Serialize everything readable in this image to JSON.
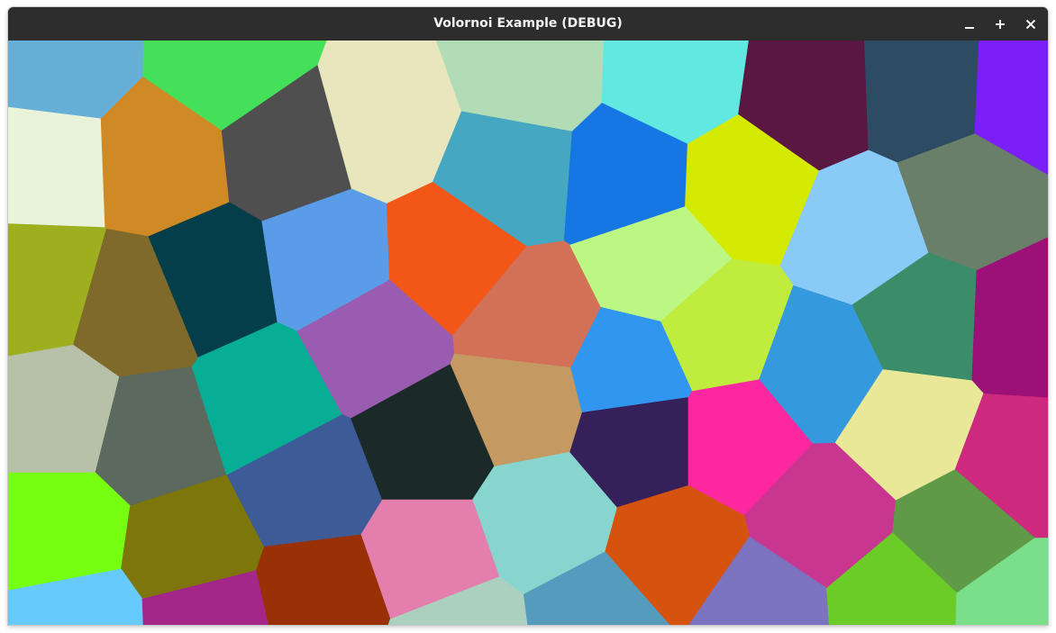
{
  "window": {
    "title": "Volornoi Example (DEBUG)",
    "controls": {
      "minimize_icon": "minimize-icon",
      "maximize_icon": "maximize-icon",
      "close_icon": "close-icon"
    }
  },
  "canvas": {
    "cell_colors": [
      "#66b0d8",
      "#44e05a",
      "#e9f3d9",
      "#d08a25",
      "#4f4f4f",
      "#e8e6bc",
      "#b1dcb6",
      "#61e9e1",
      "#5a1742",
      "#2d4c64",
      "#7b1ef8",
      "#45a7c1",
      "#1677e4",
      "#d4ea00",
      "#89caf7",
      "#6a7f69",
      "#9dae1f",
      "#7f6a2c",
      "#033e4a",
      "#5b9ce8",
      "#f35718",
      "#d37058",
      "#bcf784",
      "#c0ec3e",
      "#3b8c69",
      "#9b1177",
      "#3599de",
      "#b7c1a8",
      "#5c695e",
      "#07ad94",
      "#9a5cb0",
      "#c49a62",
      "#3096ef",
      "#e9e798",
      "#cc297f",
      "#77ff12",
      "#7d760b",
      "#3d5b96",
      "#1b2a28",
      "#88d5cf",
      "#36205a",
      "#fd28a0",
      "#c83690",
      "#5f9a47",
      "#e47ead",
      "#d6530f",
      "#66cafd",
      "#a42688",
      "#9a3005",
      "#abd0bf",
      "#559bbd",
      "#7b73c0",
      "#6bcb27",
      "#7ade8b"
    ]
  }
}
